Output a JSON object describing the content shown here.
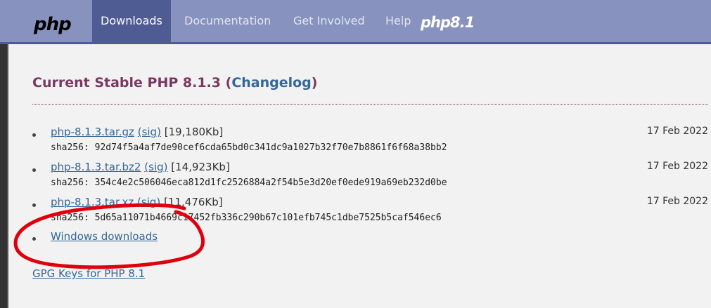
{
  "nav": {
    "logo": "php",
    "items": [
      {
        "label": "Downloads",
        "active": true
      },
      {
        "label": "Documentation",
        "active": false
      },
      {
        "label": "Get Involved",
        "active": false
      },
      {
        "label": "Help",
        "active": false
      }
    ],
    "version_badge": "php8.1"
  },
  "section": {
    "title": "Current Stable PHP 8.1.3",
    "changelog_label": "Changelog",
    "open_paren": "(",
    "close_paren": ")"
  },
  "releases": [
    {
      "file": "php-8.1.3.tar.gz",
      "sig": "(sig)",
      "size": "[19,180Kb]",
      "date": "17 Feb 2022",
      "hash": "sha256: 92d74f5a4af7de90cef6cda65bd0c341dc9a1027b32f70e7b8861f6f68a38bb2"
    },
    {
      "file": "php-8.1.3.tar.bz2",
      "sig": "(sig)",
      "size": "[14,923Kb]",
      "date": "17 Feb 2022",
      "hash": "sha256: 354c4e2c506046eca812d1fc2526884a2f54b5e3d20ef0ede919a69eb232d0be"
    },
    {
      "file": "php-8.1.3.tar.xz",
      "sig": "(sig)",
      "size": "[11,476Kb]",
      "date": "17 Feb 2022",
      "hash": "sha256: 5d65a11071b4669c17452fb336c290b67c101efb745c1dbe7525b5caf546ec6"
    }
  ],
  "windows_label": "Windows downloads",
  "gpg_label": "GPG Keys for PHP 8.1",
  "colors": {
    "nav_bg": "#8892bf",
    "nav_active": "#4f5b93",
    "title": "#793862",
    "link": "#336699",
    "annotation": "#e0000d"
  }
}
